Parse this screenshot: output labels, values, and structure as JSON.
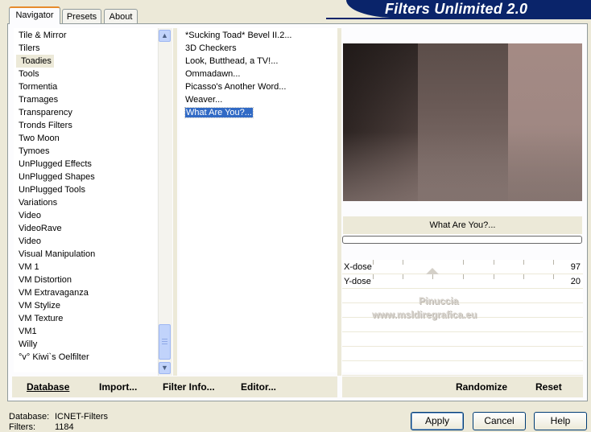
{
  "banner": {
    "title": "Filters Unlimited 2.0"
  },
  "tabs": [
    "Navigator",
    "Presets",
    "About"
  ],
  "categories": [
    "Tile & Mirror",
    "Tilers",
    "Toadies",
    "Tools",
    "Tormentia",
    "Tramages",
    "Transparency",
    "Tronds Filters",
    "Two Moon",
    "Tymoes",
    "UnPlugged Effects",
    "UnPlugged Shapes",
    "UnPlugged Tools",
    "Variations",
    "Video",
    "VideoRave",
    "Video",
    "Visual Manipulation",
    "VM 1",
    "VM Distortion",
    "VM Extravaganza",
    "VM Stylize",
    "VM Texture",
    "VM1",
    "Willy",
    "°v° Kiwi`s Oelfilter"
  ],
  "selected_category": "Toadies",
  "filters": [
    "*Sucking Toad* Bevel II.2...",
    "3D Checkers",
    "Look, Butthead, a TV!...",
    "Ommadawn...",
    "Picasso's Another Word...",
    "Weaver...",
    "What Are You?..."
  ],
  "selected_filter": "What Are You?...",
  "preview": {
    "filter_name": "What Are You?..."
  },
  "params": [
    {
      "label": "X-dose",
      "value": "97"
    },
    {
      "label": "Y-dose",
      "value": "20"
    }
  ],
  "watermark": {
    "line1": "Pinuccia",
    "line2": "www.msldiregrafica.eu"
  },
  "bottom_links": {
    "database": "Database",
    "import": "Import...",
    "filter_info": "Filter Info...",
    "editor": "Editor...",
    "randomize": "Randomize",
    "reset": "Reset"
  },
  "status": {
    "database_label": "Database:",
    "database_value": "ICNET-Filters",
    "filters_label": "Filters:",
    "filters_value": "1184"
  },
  "buttons": {
    "apply": "Apply",
    "cancel": "Cancel",
    "help": "Help"
  },
  "colors": {
    "banner": "#0a246a",
    "selection": "#316ac5",
    "face": "#ece9d8"
  }
}
